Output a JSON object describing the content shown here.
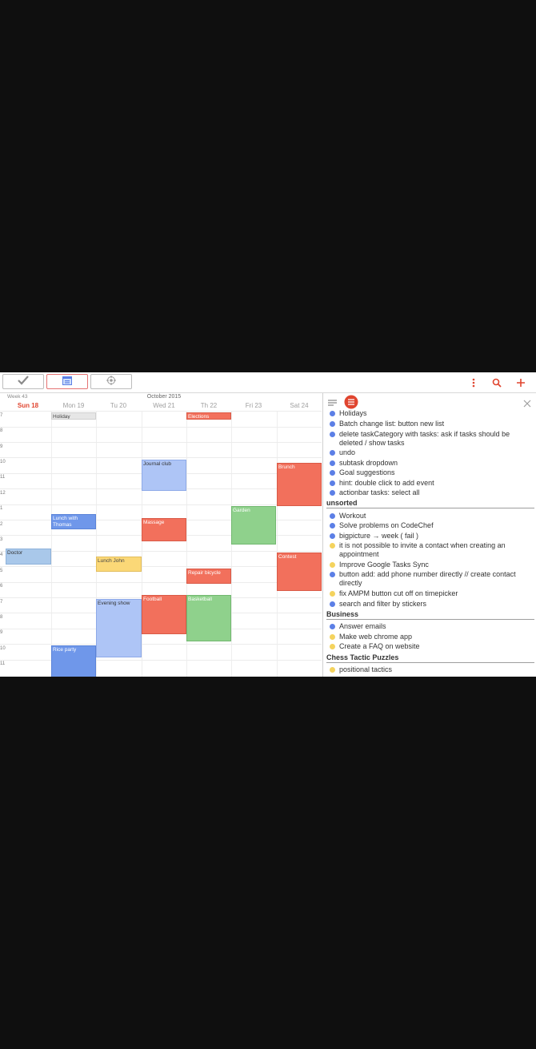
{
  "colors": {
    "accent": "#e0452f",
    "blue": "#5c7fe6",
    "yellow": "#f4d35e",
    "green": "#8fd18c",
    "red": "#f2705c"
  },
  "toolbar": {
    "buttons": [
      "check-icon",
      "calendar-icon",
      "target-icon"
    ],
    "actions": [
      "more-vert-icon",
      "search-icon",
      "add-icon"
    ]
  },
  "calendar": {
    "week_label": "Week 43",
    "month_label": "October  2015",
    "days": [
      "Sun 18",
      "Mon 19",
      "Tu 20",
      "Wed 21",
      "Th 22",
      "Fri 23",
      "Sat 24"
    ],
    "hours": [
      "7",
      "8",
      "9",
      "10",
      "11",
      "12",
      "1",
      "2",
      "3",
      "4",
      "5",
      "6",
      "7",
      "8",
      "9",
      "10",
      "11"
    ],
    "events": [
      {
        "title": "Holiday"
      },
      {
        "title": "Elections"
      },
      {
        "title": "Journal club"
      },
      {
        "title": "Brunch"
      },
      {
        "title": "Lunch with Thomas"
      },
      {
        "title": "Garden"
      },
      {
        "title": "Massage"
      },
      {
        "title": "Doctor"
      },
      {
        "title": "Lunch John"
      },
      {
        "title": "Contest"
      },
      {
        "title": "Repair bicycle"
      },
      {
        "title": "Football"
      },
      {
        "title": "Basketball"
      },
      {
        "title": "Evening show"
      },
      {
        "title": "Rice party"
      }
    ]
  },
  "tasks": {
    "header_icons": [
      "list-icon",
      "list-circle-icon",
      "close-icon"
    ],
    "top": [
      {
        "label": "Holidays",
        "color": "blue"
      },
      {
        "label": "Batch change list: button new list",
        "color": "blue"
      },
      {
        "label": "delete taskCategory with tasks: ask if tasks should be deleted / show tasks",
        "color": "blue"
      },
      {
        "label": "undo",
        "color": "blue"
      },
      {
        "label": "subtask dropdown",
        "color": "blue"
      },
      {
        "label": "Goal suggestions",
        "color": "blue"
      },
      {
        "label": "hint: double click to add event",
        "color": "blue"
      },
      {
        "label": "actionbar tasks: select all",
        "color": "blue"
      }
    ],
    "sections": [
      {
        "title": "unsorted",
        "items": [
          {
            "label": "Workout",
            "color": "blue"
          },
          {
            "label": "Solve problems on CodeChef",
            "color": "blue"
          },
          {
            "label": "bigpicture  →  week ( fail )",
            "color": "blue"
          },
          {
            "label": " it is not possible to invite a contact when creating an appointment",
            "color": "yellow"
          },
          {
            "label": "Improve Google Tasks Sync",
            "color": "yellow"
          },
          {
            "label": "button add: add phone number directly // create contact directly",
            "color": "blue"
          },
          {
            "label": "fix AMPM button cut off on timepicker",
            "color": "yellow"
          },
          {
            "label": "search and filter by stickers",
            "color": "blue"
          }
        ]
      },
      {
        "title": "Business",
        "items": [
          {
            "label": "Answer emails",
            "color": "blue"
          },
          {
            "label": "Make web chrome app",
            "color": "yellow"
          },
          {
            "label": "Create a FAQ on website",
            "color": "yellow"
          }
        ]
      },
      {
        "title": "Chess Tactic Puzzles",
        "items": [
          {
            "label": "positional tactics",
            "color": "yellow"
          }
        ]
      }
    ]
  }
}
